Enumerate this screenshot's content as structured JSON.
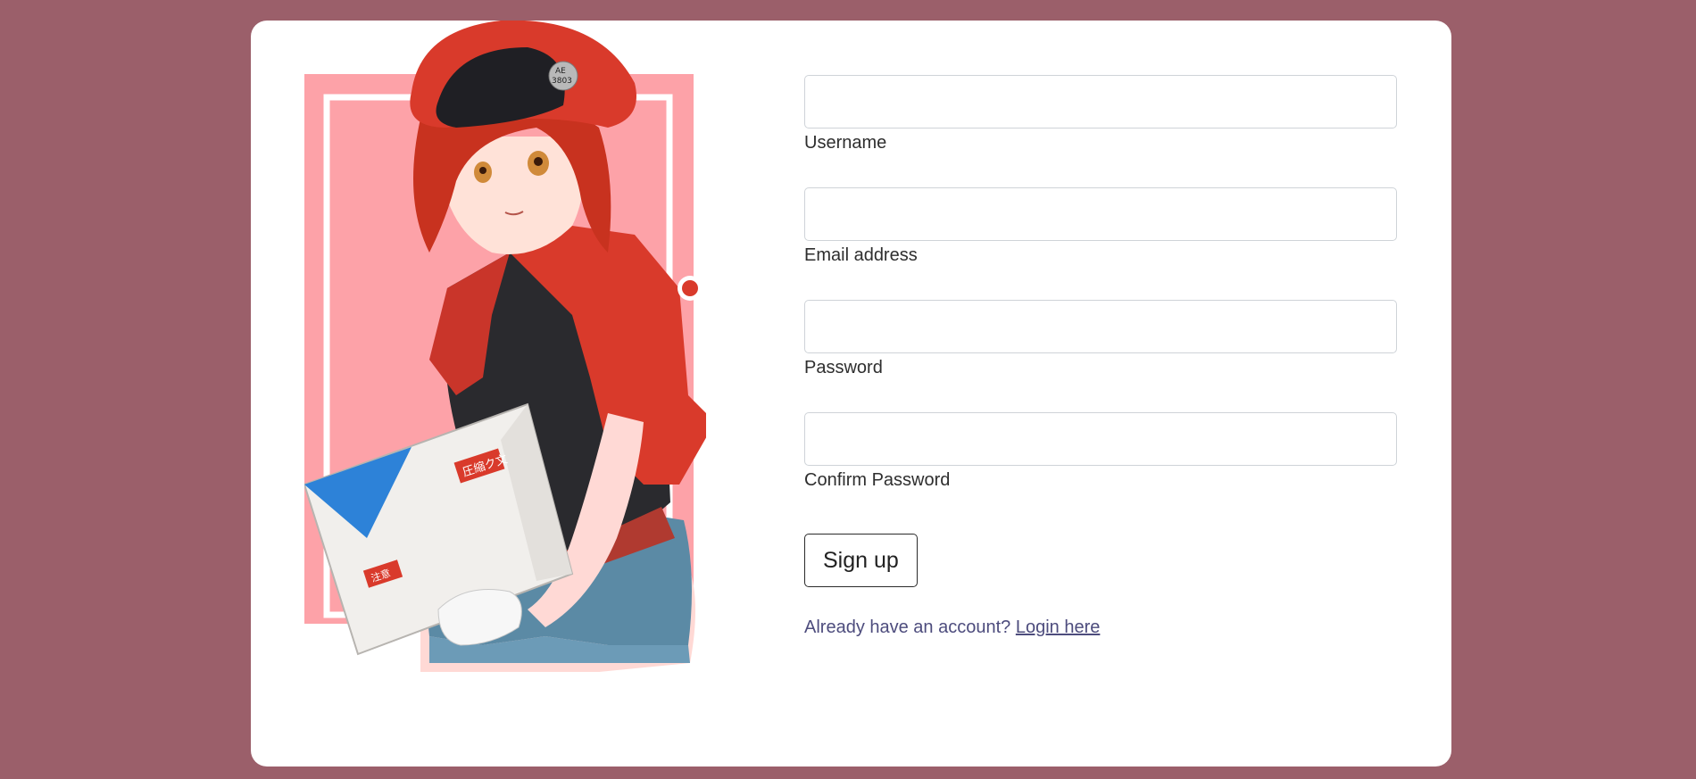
{
  "illustration": {
    "badge_text_top": "AE",
    "badge_text_bottom": "3803",
    "box_label_1": "圧縮ク文",
    "box_label_2": "注意"
  },
  "form": {
    "username_label": "Username",
    "email_label": "Email address",
    "password_label": "Password",
    "confirm_password_label": "Confirm Password",
    "signup_label": "Sign up",
    "login_prompt": "Already have an account?",
    "login_link": "Login here"
  },
  "colors": {
    "page_background": "#9b5f6a",
    "card_background": "#ffffff",
    "link_color": "#4d4c7d",
    "art_pink": "#fda2a8",
    "art_red": "#d93a2b"
  }
}
